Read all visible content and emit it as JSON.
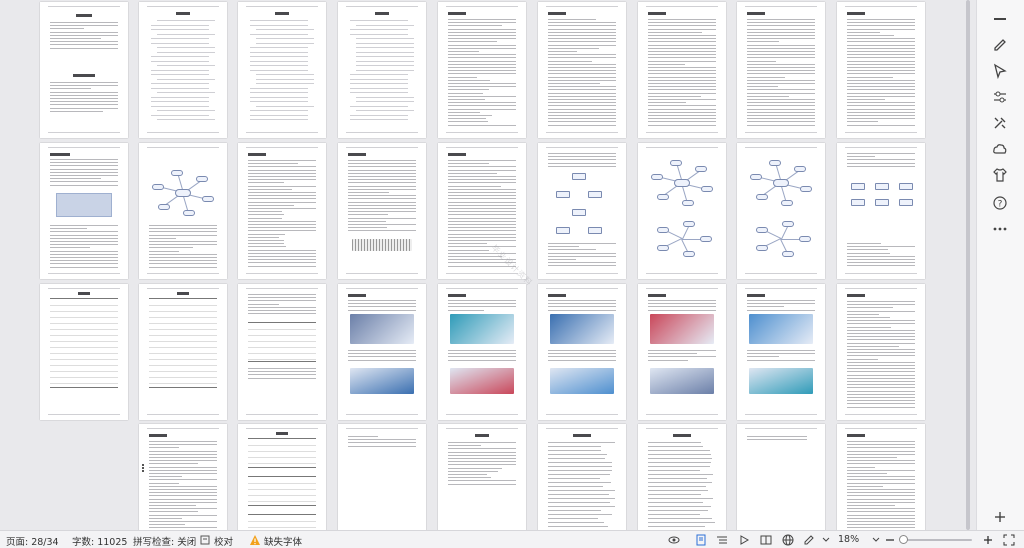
{
  "document": {
    "current_page": 28,
    "total_pages": 34,
    "word_count": 11025,
    "watermark": "毕业设计资料"
  },
  "statusbar": {
    "page_label": "页面: 28/34",
    "words_label": "字数: 11025",
    "spellcheck_label": "拼写检查: 关闭",
    "proofread_label": "校对",
    "missing_font_label": "缺失字体",
    "zoom_label": "18%",
    "zoom_level_percent": 18
  },
  "right_toolbar": {
    "tools": [
      {
        "name": "collapse-icon"
      },
      {
        "name": "pen-icon"
      },
      {
        "name": "select-pointer-icon"
      },
      {
        "name": "adjust-icon"
      },
      {
        "name": "tools-icon"
      },
      {
        "name": "cloud-sync-icon"
      },
      {
        "name": "shirt-icon"
      },
      {
        "name": "help-icon"
      },
      {
        "name": "more-icon"
      }
    ]
  },
  "colors": {
    "accent": "#2b6fd6",
    "warning": "#f2a11c",
    "page_bg": "#ffffff",
    "canvas_bg": "#e9e9ec"
  }
}
